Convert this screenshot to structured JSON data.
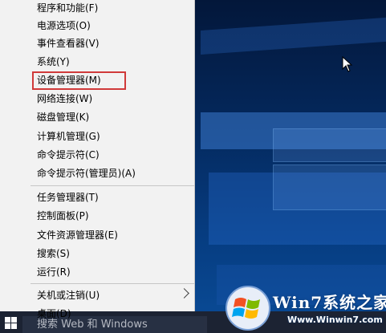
{
  "menu": {
    "items": [
      "程序和功能(F)",
      "电源选项(O)",
      "事件查看器(V)",
      "系统(Y)",
      "设备管理器(M)",
      "网络连接(W)",
      "磁盘管理(K)",
      "计算机管理(G)",
      "命令提示符(C)",
      "命令提示符(管理员)(A)",
      "任务管理器(T)",
      "控制面板(P)",
      "文件资源管理器(E)",
      "搜索(S)",
      "运行(R)",
      "关机或注销(U)",
      "桌面(D)"
    ],
    "highlighted_item": "设备管理器(M)"
  },
  "taskbar": {
    "search_text": "搜索 Web 和 Windows"
  },
  "watermark": {
    "title": "Win7系统之家",
    "url": "Www.Winwin7.com"
  },
  "colors": {
    "highlight_border": "#d03a3a",
    "menu_background": "#f2f2f2"
  }
}
